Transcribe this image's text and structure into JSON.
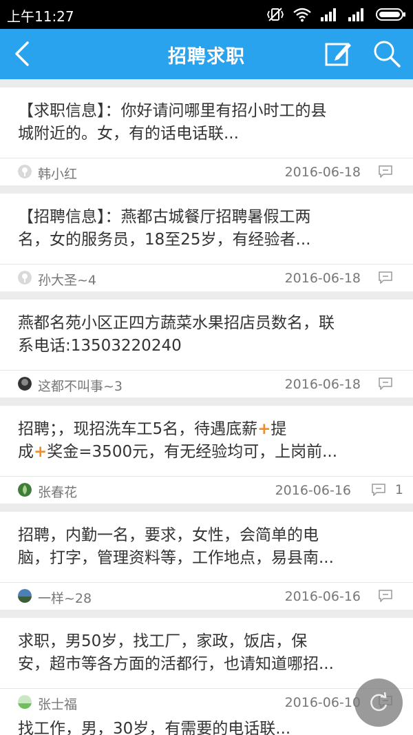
{
  "status": {
    "time": "上午11:27"
  },
  "header": {
    "title": "招聘求职"
  },
  "posts": [
    {
      "line1": "【求职信息】：你好请问哪里有招小时工的县",
      "line2": "城附近的。女，有的话电话联...",
      "author": "韩小红",
      "date": "2016-06-18",
      "comments": ""
    },
    {
      "line1": "【招聘信息】：燕都古城餐厅招聘暑假工两",
      "line2": "名，女的服务员，18至25岁，有经验者...",
      "author": "孙大圣~4",
      "date": "2016-06-18",
      "comments": ""
    },
    {
      "line1": "燕都名苑小区正四方蔬菜水果招店员数名，联",
      "line2": "系电话:13503220240",
      "author": "这都不叫事~3",
      "date": "2016-06-18",
      "comments": ""
    },
    {
      "line1a": "招聘；，现招洗车工5名，待遇底薪",
      "line1b": "提",
      "line2a": "成",
      "line2b": "奖金=3500元，有无经验均可，上岗前...",
      "plus": "+",
      "author": "张春花",
      "date": "2016-06-16",
      "comments": "1"
    },
    {
      "line1": "招聘，内勤一名，要求，女性，会简单的电",
      "line2": "脑，打字，管理资料等，工作地点，易县南...",
      "author": "一样~28",
      "date": "2016-06-16",
      "comments": ""
    },
    {
      "line1": "求职，男50岁，找工厂，家政，饭店，保",
      "line2": "安，超市等各方面的活都行，也请知道哪招...",
      "author": "张士福",
      "date": "2016-06-10",
      "comments": ""
    }
  ],
  "partial_post": "找工作，男，30岁，有需要的电话联..."
}
